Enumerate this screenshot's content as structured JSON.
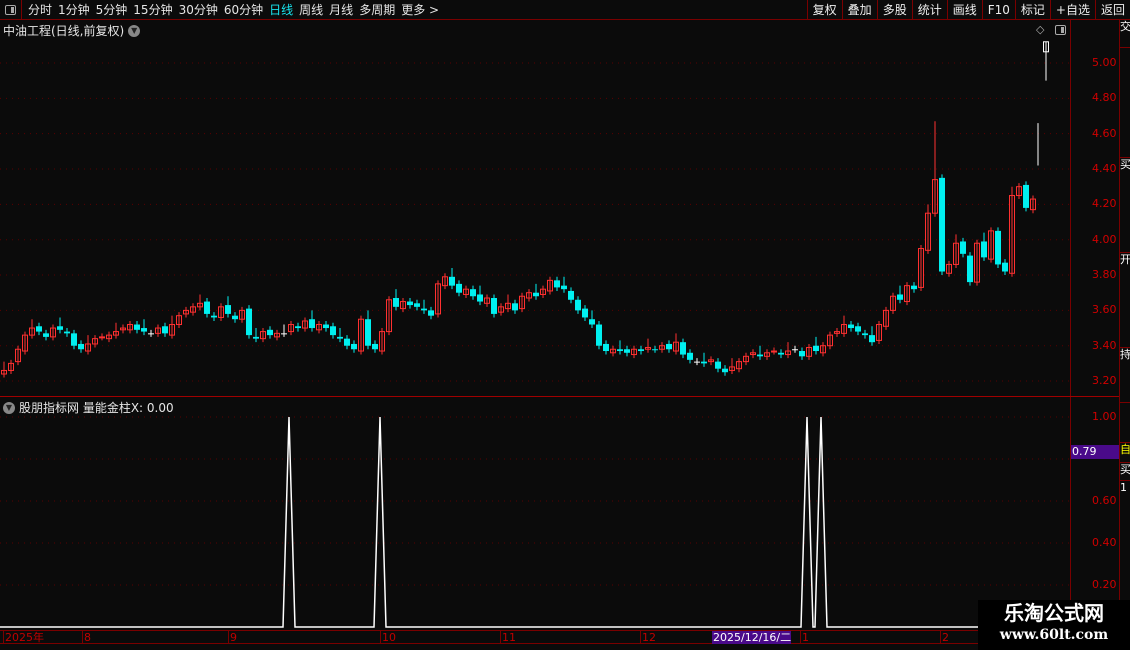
{
  "toolbar": {
    "periods": [
      "分时",
      "1分钟",
      "5分钟",
      "15分钟",
      "30分钟",
      "60分钟",
      "日线",
      "周线",
      "月线",
      "多周期",
      "更多 >"
    ],
    "active_period": "日线",
    "right_buttons": [
      "复权",
      "叠加",
      "多股",
      "统计",
      "画线",
      "F10",
      "标记",
      "+自选",
      "返回"
    ]
  },
  "title": "中油工程(日线,前复权)",
  "indicator": {
    "title": "股朋指标网 量能金柱X: 0.00",
    "current_value_label": "0.79"
  },
  "price_axis": {
    "labels": [
      "5.00",
      "4.80",
      "4.60",
      "4.40",
      "4.20",
      "4.00",
      "3.80",
      "3.60",
      "3.40",
      "3.20"
    ]
  },
  "indicator_axis": {
    "labels": [
      "1.00",
      "0.60",
      "0.40",
      "0.20"
    ]
  },
  "date_axis": [
    "2025年",
    "8",
    "9",
    "10",
    "11",
    "12",
    "2025/12/16/二",
    "1",
    "2"
  ],
  "watermark": {
    "line1": "乐淘公式网",
    "line2": "www.60lt.com"
  },
  "colors": {
    "up": "#ff3030",
    "down": "#00f0f0",
    "flat": "#ffffff",
    "axis": "#d00000",
    "highlight": "#4a0a8a"
  },
  "chart_data": {
    "type": "candlestick",
    "ylim": [
      3.15,
      5.2
    ],
    "closes": [
      3.26,
      3.3,
      3.38,
      3.46,
      3.5,
      3.48,
      3.45,
      3.5,
      3.49,
      3.47,
      3.4,
      3.38,
      3.41,
      3.44,
      3.45,
      3.46,
      3.48,
      3.5,
      3.52,
      3.49,
      3.48,
      3.47,
      3.5,
      3.47,
      3.52,
      3.57,
      3.6,
      3.62,
      3.64,
      3.58,
      3.56,
      3.62,
      3.58,
      3.55,
      3.6,
      3.46,
      3.44,
      3.48,
      3.46,
      3.47,
      3.47,
      3.52,
      3.5,
      3.54,
      3.5,
      3.52,
      3.5,
      3.46,
      3.44,
      3.4,
      3.38,
      3.55,
      3.4,
      3.38,
      3.48,
      3.66,
      3.62,
      3.65,
      3.63,
      3.62,
      3.6,
      3.57,
      3.75,
      3.79,
      3.74,
      3.7,
      3.72,
      3.68,
      3.65,
      3.67,
      3.58,
      3.62,
      3.64,
      3.6,
      3.68,
      3.7,
      3.68,
      3.72,
      3.77,
      3.73,
      3.72,
      3.66,
      3.6,
      3.56,
      3.52,
      3.4,
      3.37,
      3.38,
      3.37,
      3.36,
      3.38,
      3.37,
      3.39,
      3.38,
      3.4,
      3.38,
      3.42,
      3.35,
      3.32,
      3.31,
      3.3,
      3.32,
      3.27,
      3.25,
      3.28,
      3.31,
      3.34,
      3.36,
      3.34,
      3.36,
      3.37,
      3.35,
      3.37,
      3.38,
      3.34,
      3.39,
      3.37,
      3.4,
      3.46,
      3.48,
      3.52,
      3.5,
      3.48,
      3.46,
      3.42,
      3.52,
      3.6,
      3.68,
      3.66,
      3.74,
      3.72,
      3.95,
      4.15,
      4.34,
      3.82,
      3.86,
      3.98,
      3.92,
      3.76,
      3.98,
      3.9,
      4.05,
      3.86,
      3.82,
      4.25,
      4.3,
      4.18,
      4.23
    ],
    "indicator_signal_bars": [
      41,
      54,
      115,
      117
    ],
    "indicator_ylim": [
      0,
      1
    ]
  }
}
